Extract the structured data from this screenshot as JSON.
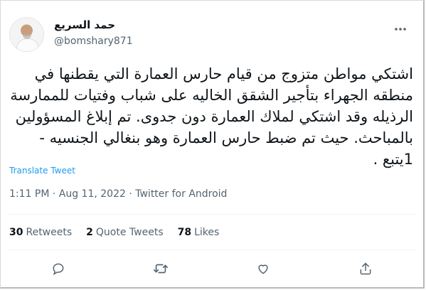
{
  "tweet": {
    "author_name": "حمد السريع",
    "author_handle": "@bomshary871",
    "text": "اشتكي مواطن متزوج من قيام حارس العمارة التي يقطنها في منطقه الجهراء بتأجير الشقق الخاليه على شباب وفتيات للممارسة الرذيله وقد اشتكي لملاك العمارة دون جدوى. تم إبلاغ المسؤولين بالمباحث. حيث تم ضبط حارس العمارة وهو بنغالي الجنسيه - 1يتبع .",
    "translate_label": "Translate Tweet",
    "metadata": "1:11 PM · Aug 11, 2022 · Twitter for Android"
  },
  "stats": {
    "retweets_count": "30",
    "retweets_label": "Retweets",
    "quote_count": "2",
    "quote_label": "Quote Tweets",
    "likes_count": "78",
    "likes_label": "Likes"
  },
  "icons": {
    "more": "more-horizontal-icon",
    "reply": "reply-icon",
    "retweet": "retweet-icon",
    "like": "heart-icon",
    "share": "share-icon"
  },
  "colors": {
    "text": "#0f1419",
    "secondary": "#536471",
    "link": "#1d9bf0",
    "divider": "#eff3f4"
  }
}
